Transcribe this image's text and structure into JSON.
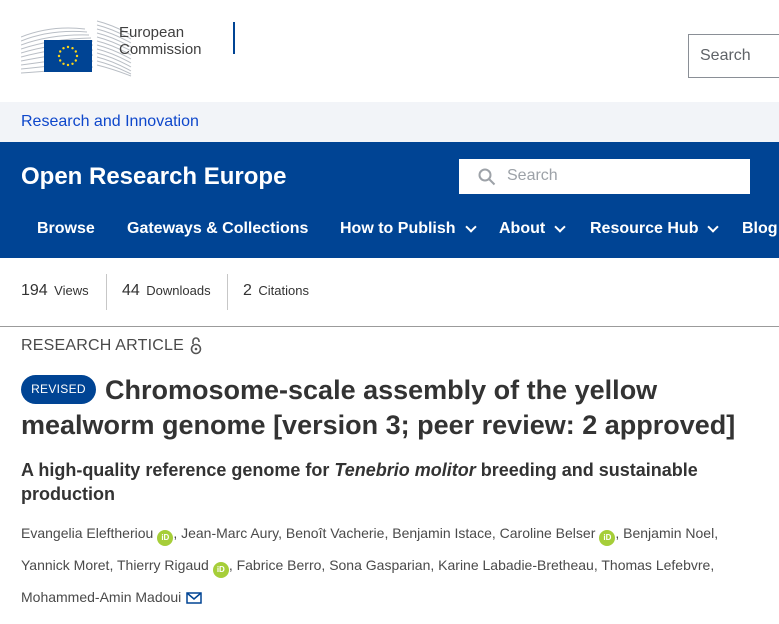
{
  "ec_header": {
    "logo_line1": "European",
    "logo_line2": "Commission",
    "search_placeholder": "Search"
  },
  "breadcrumb": {
    "label": "Research and Innovation"
  },
  "site": {
    "title": "Open Research Europe",
    "search_placeholder": "Search",
    "nav": [
      {
        "label": "Browse"
      },
      {
        "label": "Gateways & Collections"
      },
      {
        "label": "How to Publish"
      },
      {
        "label": "About"
      },
      {
        "label": "Resource Hub"
      },
      {
        "label": "Blog"
      }
    ]
  },
  "metrics": [
    {
      "value": "194",
      "label": "Views"
    },
    {
      "value": "44",
      "label": "Downloads"
    },
    {
      "value": "2",
      "label": "Citations"
    }
  ],
  "article": {
    "type": "RESEARCH ARTICLE",
    "badge": "REVISED",
    "title": "Chromosome-scale assembly of the yellow mealworm genome [version 3; peer review: 2 approved]",
    "subtitle_pre": "A high-quality reference genome for ",
    "subtitle_em": "Tenebrio molitor",
    "subtitle_post": " breeding and sustainable production",
    "authors": [
      "Evangelia Eleftheriou",
      "Jean-Marc Aury",
      "Benoît Vacherie",
      "Benjamin Istace",
      "Caroline Belser",
      "Benjamin Noel",
      "Yannick Moret",
      "Thierry Rigaud",
      "Fabrice Berro",
      "Sona Gasparian",
      "Karine Labadie-Bretheau",
      "Thomas Lefebvre",
      "Mohammed-Amin Madoui"
    ],
    "orcid_label": "iD"
  },
  "colors": {
    "ec_blue": "#004494",
    "link_blue": "#0e47cb",
    "orcid_green": "#a6ce39",
    "star_yellow": "#ffd617"
  }
}
